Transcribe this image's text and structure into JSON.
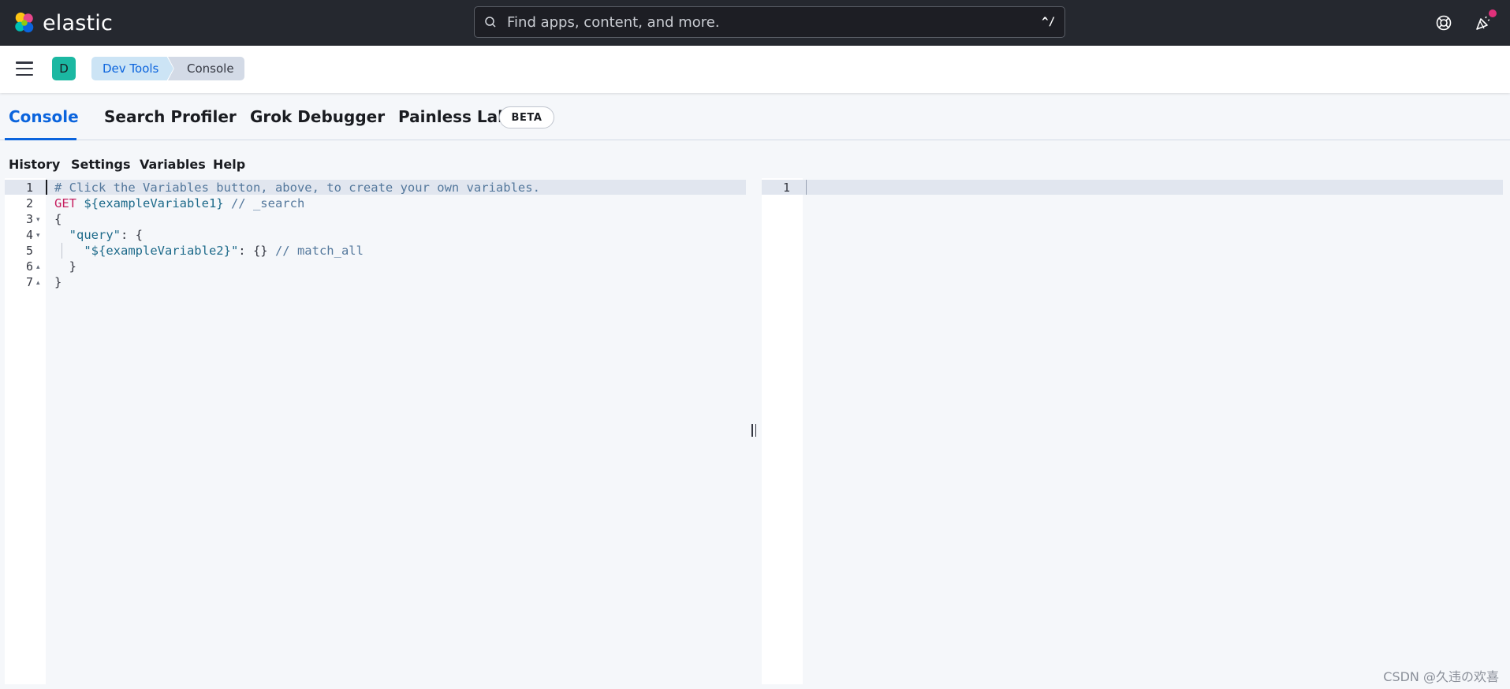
{
  "header": {
    "brand": "elastic",
    "search_placeholder": "Find apps, content, and more.",
    "search_shortcut": "^/",
    "colors": {
      "bg": "#25282f",
      "notification_dot": "#e0307a"
    }
  },
  "subbar": {
    "avatar_letter": "D",
    "breadcrumbs": [
      {
        "label": "Dev Tools"
      },
      {
        "label": "Console"
      }
    ]
  },
  "tabs": [
    {
      "label": "Console",
      "active": true
    },
    {
      "label": "Search Profiler",
      "active": false
    },
    {
      "label": "Grok Debugger",
      "active": false
    },
    {
      "label": "Painless Lab",
      "active": false,
      "badge": "BETA"
    }
  ],
  "console_toolbar": {
    "items": [
      "History",
      "Settings",
      "Variables",
      "Help"
    ]
  },
  "editor": {
    "line_numbers": [
      "1",
      "2",
      "3",
      "4",
      "5",
      "6",
      "7"
    ],
    "lines": [
      "# Click the Variables button, above, to create your own variables.",
      "GET ${exampleVariable1} // _search",
      "{",
      "  \"query\": {",
      "    \"${exampleVariable2}\": {} // match_all",
      "  }",
      "}"
    ]
  },
  "output": {
    "line_numbers": [
      "1"
    ]
  },
  "watermark": "CSDN @久违の欢喜"
}
